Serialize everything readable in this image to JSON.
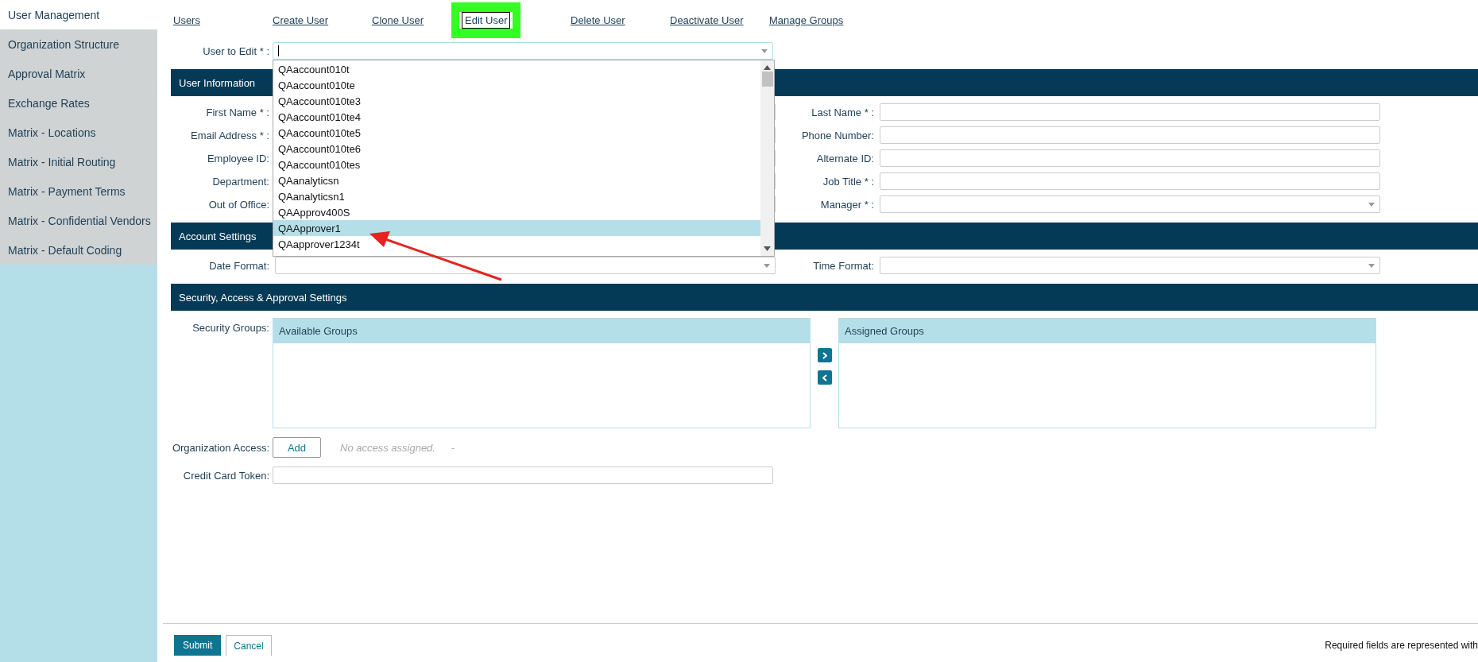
{
  "sidebar": {
    "items": [
      {
        "label": "User Management",
        "selected": true
      },
      {
        "label": "Organization Structure",
        "selected": false
      },
      {
        "label": "Approval Matrix",
        "selected": false
      },
      {
        "label": "Exchange Rates",
        "selected": false
      },
      {
        "label": "Matrix - Locations",
        "selected": false
      },
      {
        "label": "Matrix - Initial Routing",
        "selected": false
      },
      {
        "label": "Matrix - Payment Terms",
        "selected": false
      },
      {
        "label": "Matrix - Confidential Vendors",
        "selected": false
      },
      {
        "label": "Matrix - Default Coding",
        "selected": false
      }
    ]
  },
  "nav": {
    "links": [
      {
        "label": "Users",
        "selected": false
      },
      {
        "label": "Create User",
        "selected": false
      },
      {
        "label": "Clone User",
        "selected": false
      },
      {
        "label": "Edit User",
        "selected": true
      },
      {
        "label": "Delete User",
        "selected": false
      },
      {
        "label": "Deactivate User",
        "selected": false
      },
      {
        "label": "Manage Groups",
        "selected": false
      }
    ]
  },
  "user_to_edit": {
    "label": "User to Edit * :",
    "options": [
      {
        "label": "QAaccount010t",
        "selected": false
      },
      {
        "label": "QAaccount010te",
        "selected": false
      },
      {
        "label": "QAaccount010te3",
        "selected": false
      },
      {
        "label": "QAaccount010te4",
        "selected": false
      },
      {
        "label": "QAaccount010te5",
        "selected": false
      },
      {
        "label": "QAaccount010te6",
        "selected": false
      },
      {
        "label": "QAaccount010tes",
        "selected": false
      },
      {
        "label": "QAanalyticsn",
        "selected": false
      },
      {
        "label": "QAanalyticsn1",
        "selected": false
      },
      {
        "label": "QAApprov400S",
        "selected": false
      },
      {
        "label": "QAApprover1",
        "selected": true
      },
      {
        "label": "QAapprover1234t",
        "selected": false
      }
    ]
  },
  "user_information": {
    "title": "User Information",
    "left_fields": [
      {
        "label": "First Name * :"
      },
      {
        "label": "Email Address * :"
      },
      {
        "label": "Employee ID:"
      },
      {
        "label": "Department:"
      },
      {
        "label": "Out of Office:"
      }
    ],
    "right_fields": [
      {
        "label": "Last Name * :",
        "kind": "text"
      },
      {
        "label": "Phone Number:",
        "kind": "text"
      },
      {
        "label": "Alternate ID:",
        "kind": "text"
      },
      {
        "label": "Job Title * :",
        "kind": "text"
      },
      {
        "label": "Manager * :",
        "kind": "select"
      }
    ]
  },
  "account_settings": {
    "title": "Account Settings",
    "left_fields": [
      {
        "label": "Date Format:",
        "kind": "select"
      }
    ],
    "right_fields": [
      {
        "label": "Time Format:",
        "kind": "select"
      }
    ]
  },
  "security": {
    "title": "Security, Access & Approval Settings",
    "security_groups_label": "Security Groups:",
    "available_title": "Available Groups",
    "assigned_title": "Assigned Groups",
    "org_access_label": "Organization Access:",
    "add_button": "Add",
    "no_access_text": "No access assigned.",
    "separator": "-",
    "credit_card_label": "Credit Card Token:"
  },
  "footer": {
    "submit": "Submit",
    "cancel": "Cancel",
    "note": "Required fields are represented with"
  }
}
